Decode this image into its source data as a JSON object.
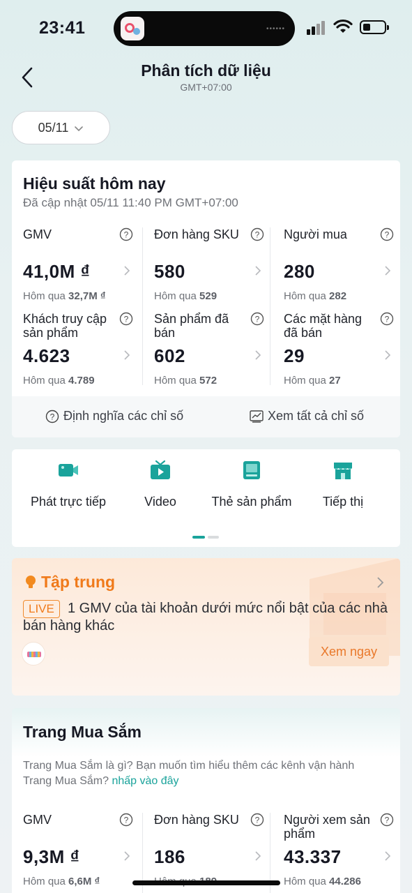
{
  "status_bar": {
    "time": "23:41"
  },
  "header": {
    "title": "Phân tích dữ liệu",
    "subtitle": "GMT+07:00"
  },
  "date_filter": {
    "value": "05/11"
  },
  "performance": {
    "title": "Hiệu suất hôm nay",
    "updated": "Đã cập nhật 05/11 11:40 PM GMT+07:00",
    "metrics": [
      {
        "label": "GMV",
        "value": "41,0M ₫",
        "prev_label": "Hôm qua",
        "prev_value": "32,7M ₫"
      },
      {
        "label": "Đơn hàng SKU",
        "value": "580",
        "prev_label": "Hôm qua",
        "prev_value": "529"
      },
      {
        "label": "Người mua",
        "value": "280",
        "prev_label": "Hôm qua",
        "prev_value": "282"
      },
      {
        "label": "Khách truy cập sản phẩm",
        "value": "4.623",
        "prev_label": "Hôm qua",
        "prev_value": "4.789"
      },
      {
        "label": "Sản phẩm đã bán",
        "value": "602",
        "prev_label": "Hôm qua",
        "prev_value": "572"
      },
      {
        "label": "Các mặt hàng đã bán",
        "value": "29",
        "prev_label": "Hôm qua",
        "prev_value": "27"
      }
    ],
    "definitions_link": "Định nghĩa các chỉ số",
    "view_all_link": "Xem tất cả chỉ số"
  },
  "channels": [
    {
      "label": "Phát trực tiếp",
      "icon": "live-camera-icon"
    },
    {
      "label": "Video",
      "icon": "video-tv-icon"
    },
    {
      "label": "Thẻ sản phẩm",
      "icon": "product-card-icon"
    },
    {
      "label": "Tiếp thị",
      "icon": "store-marketing-icon"
    }
  ],
  "focus": {
    "title": "Tập trung",
    "badge": "LIVE",
    "message": "1 GMV của tài khoản dưới mức nổi bật của các nhà bán hàng khác",
    "action": "Xem ngay"
  },
  "shop": {
    "title": "Trang Mua Sắm",
    "description": "Trang Mua Sắm là gì? Bạn muốn tìm hiểu thêm các kênh vận hành Trang Mua Sắm?",
    "link": "nhấp vào đây",
    "metrics": [
      {
        "label": "GMV",
        "value": "9,3M ₫",
        "prev_label": "Hôm qua",
        "prev_value": "6,6M ₫"
      },
      {
        "label": "Đơn hàng SKU",
        "value": "186",
        "prev_label": "Hôm qua",
        "prev_value": "189"
      },
      {
        "label": "Người xem sản phẩm",
        "value": "43.337",
        "prev_label": "Hôm qua",
        "prev_value": "44.286"
      }
    ]
  },
  "colors": {
    "accent": "#1aa39b",
    "focus_orange": "#f07a1a"
  }
}
